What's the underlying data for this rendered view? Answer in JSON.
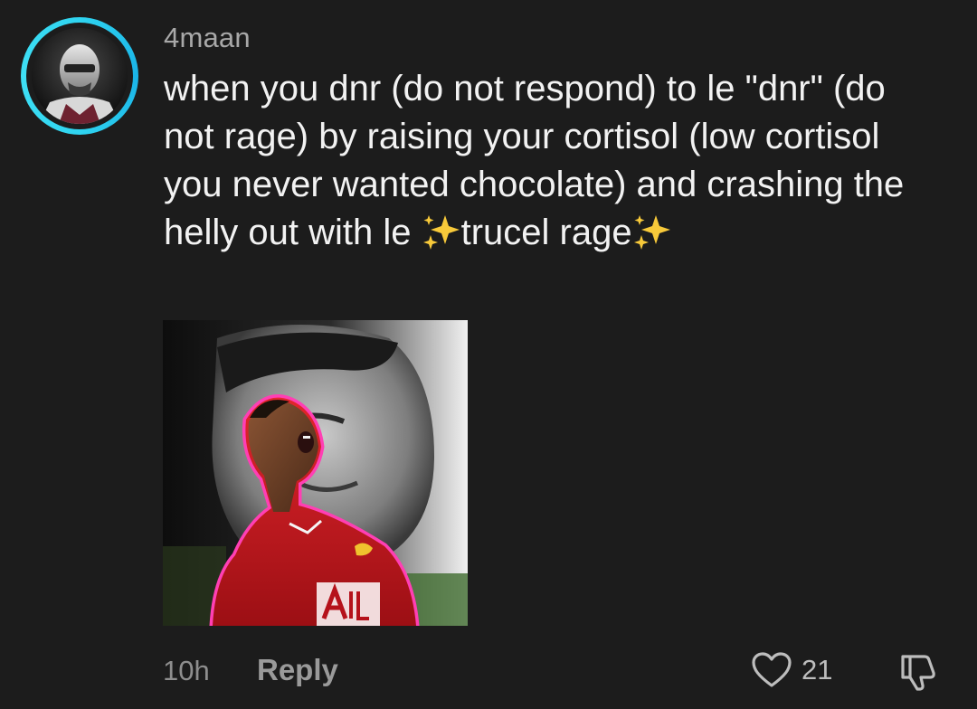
{
  "comment": {
    "username": "4maan",
    "text_part1": "when you dnr (do not respond) to le \"dnr\" (do not rage) by raising your cortisol (low cortisol you never wanted chocolate) and crashing the helly out with le ",
    "text_part2": "trucel rage",
    "sparkle_icon": "sparkles-emoji",
    "time": "10h",
    "reply_label": "Reply",
    "like_count": "21"
  },
  "colors": {
    "background": "#1c1c1c",
    "avatar_ring": "#2fd4f0",
    "text_primary": "#f2f2f2",
    "text_secondary": "#a8a8a8"
  },
  "icons": {
    "like": "heart-outline-icon",
    "dislike": "thumbs-down-outline-icon"
  }
}
